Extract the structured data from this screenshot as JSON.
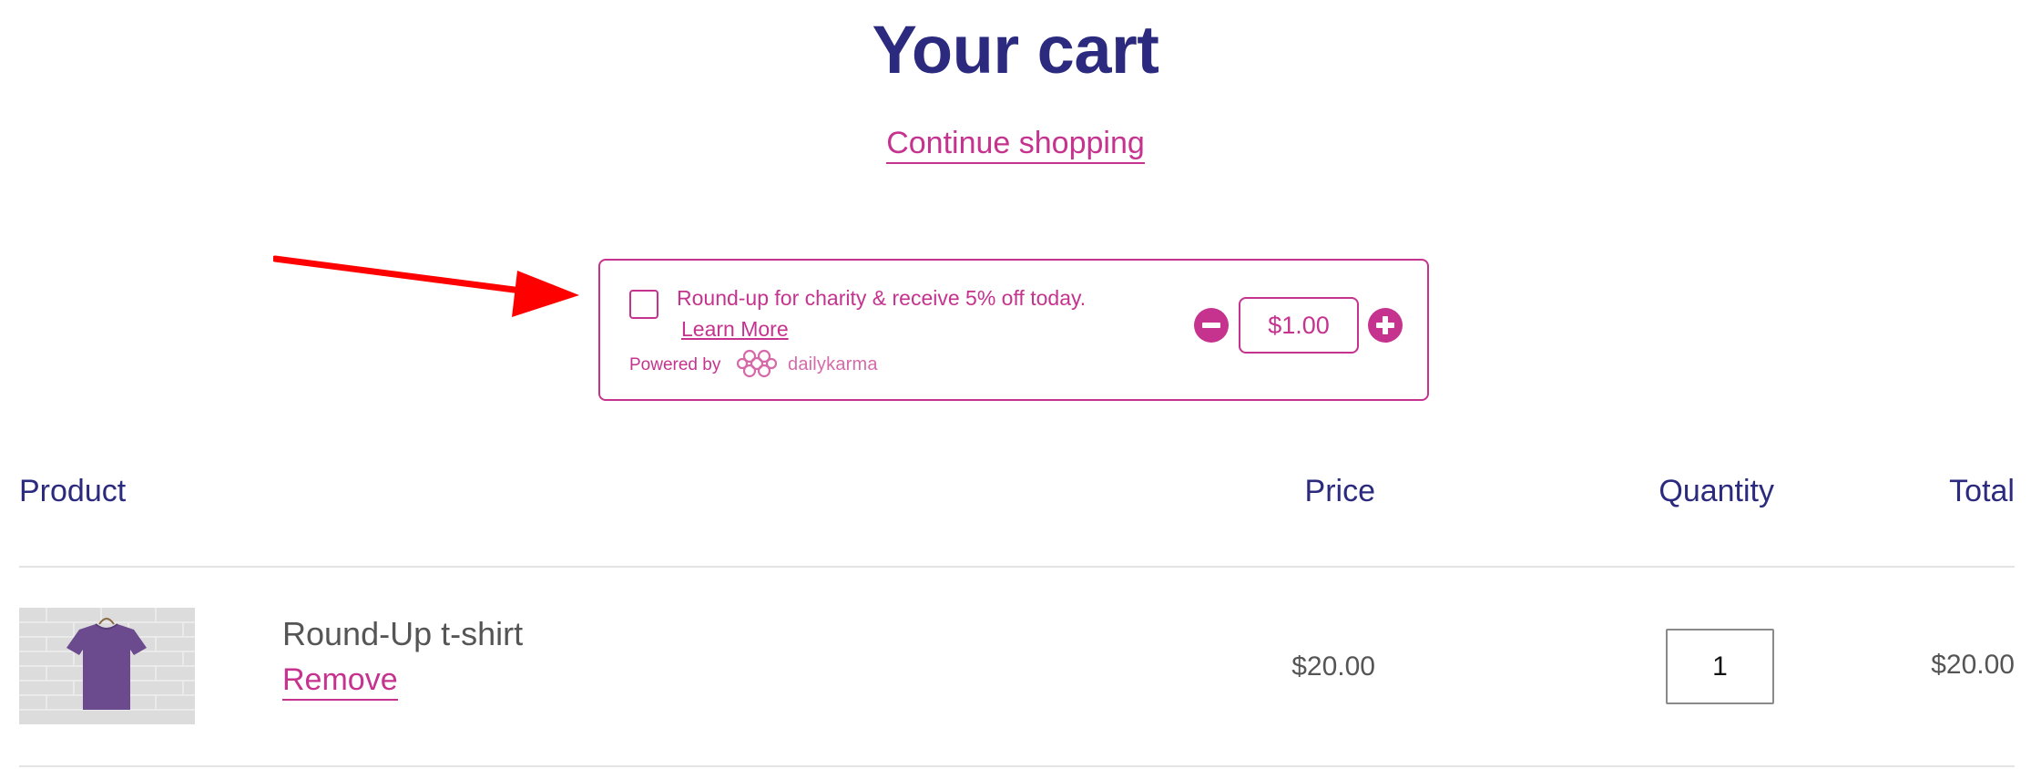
{
  "header": {
    "title": "Your cart",
    "continue_shopping": "Continue shopping"
  },
  "charity": {
    "message": "Round-up for charity & receive 5% off today.",
    "learn_more": "Learn More",
    "powered_by": "Powered by",
    "brand": "dailykarma",
    "amount": "$1.00",
    "checked": false
  },
  "table": {
    "headers": {
      "product": "Product",
      "price": "Price",
      "quantity": "Quantity",
      "total": "Total"
    },
    "rows": [
      {
        "name": "Round-Up t-shirt",
        "remove_label": "Remove",
        "price": "$20.00",
        "quantity": "1",
        "total": "$20.00"
      }
    ]
  },
  "colors": {
    "heading": "#2b2a7e",
    "accent": "#c5338f",
    "annotation_arrow": "#ff0000",
    "shirt": "#6b4b8e"
  },
  "icons": {
    "annotation": "red-arrow-icon",
    "decrement": "minus-circle-icon",
    "increment": "plus-circle-icon",
    "brand_logo": "dailykarma-knot-icon"
  }
}
